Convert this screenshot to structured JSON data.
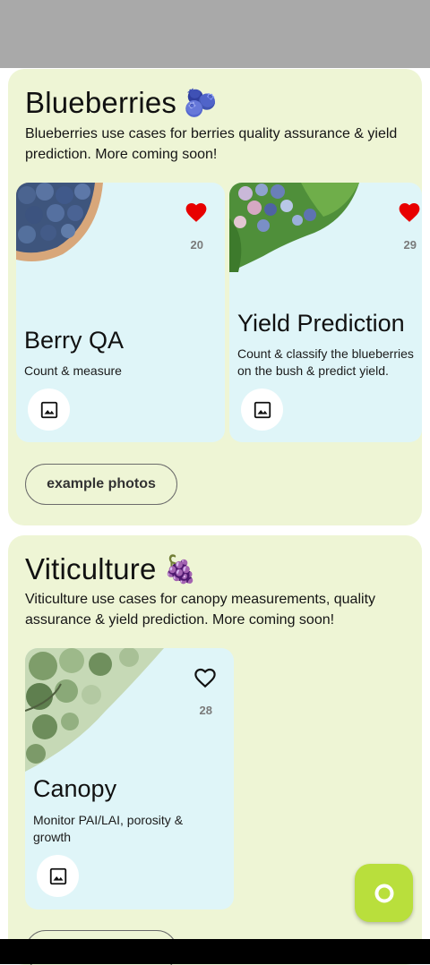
{
  "sections": [
    {
      "title": "Blueberries",
      "emoji": "🫐",
      "description": "Blueberries use cases for berries quality assurance & yield prediction. More coming soon!",
      "cards": [
        {
          "title": "Berry QA",
          "subtitle": "Count & measure",
          "favorite": true,
          "count": "20",
          "image_icon": "image-icon"
        },
        {
          "title": "Yield Prediction",
          "subtitle": "Count & classify the blueberries on the bush & predict yield.",
          "favorite": true,
          "count": "29",
          "image_icon": "image-icon"
        }
      ],
      "button_label": "example photos"
    },
    {
      "title": "Viticulture",
      "emoji": "🍇",
      "description": "Viticulture use cases for canopy measurements, quality assurance & yield prediction. More coming soon!",
      "cards": [
        {
          "title": "Canopy",
          "subtitle": "Monitor PAI/LAI, porosity & growth",
          "favorite": false,
          "count": "28",
          "image_icon": "image-icon"
        }
      ]
    }
  ],
  "colors": {
    "section_bg": "#eef5d5",
    "card_bg": "#dff5f8",
    "heart_filled": "#e80000",
    "fab": "#b9df3c"
  },
  "icons": {
    "fab": "circle-icon",
    "favorite_filled": "heart-filled-icon",
    "favorite_outline": "heart-outline-icon"
  }
}
